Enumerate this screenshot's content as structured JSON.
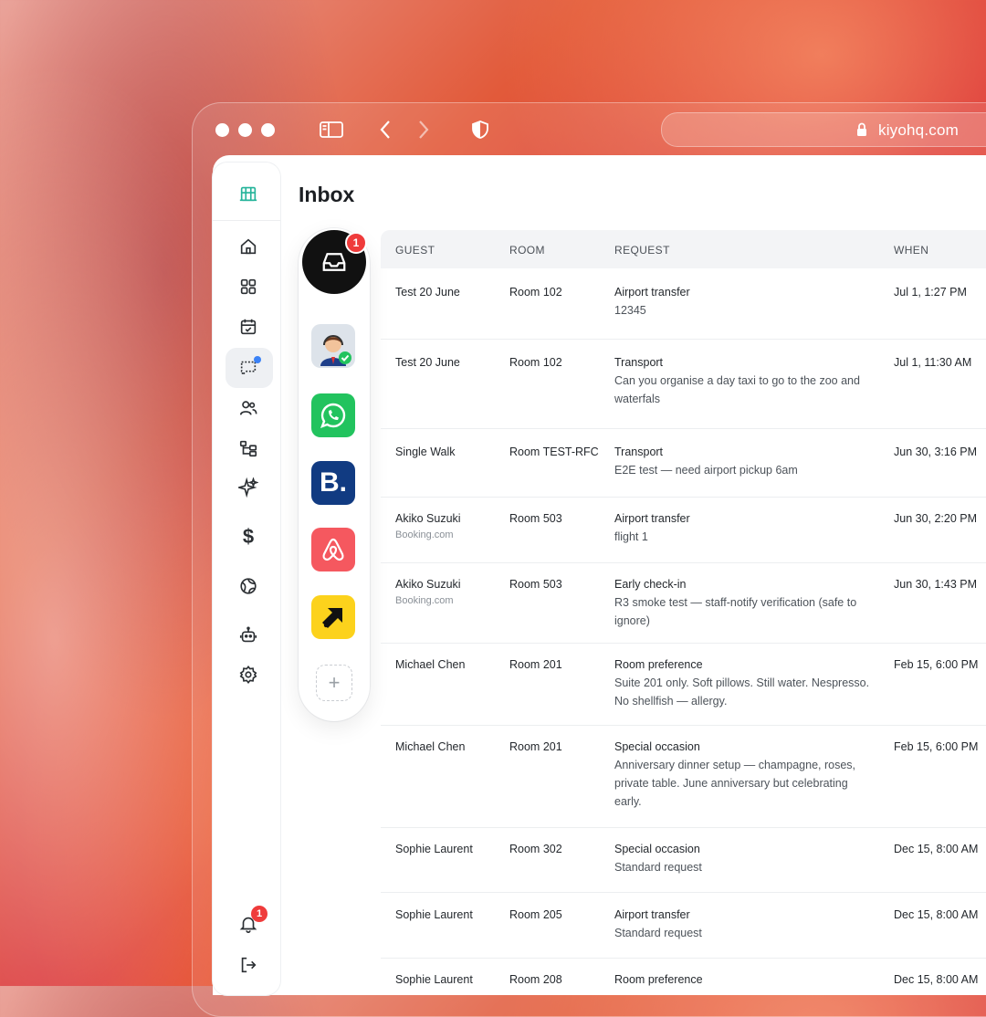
{
  "browser": {
    "url": "kiyohq.com"
  },
  "page": {
    "title": "Inbox"
  },
  "sidebar": {
    "items": [
      {
        "icon": "hotel-logo-icon"
      },
      {
        "icon": "home-icon"
      },
      {
        "icon": "grid-icon"
      },
      {
        "icon": "calendar-icon"
      },
      {
        "icon": "messages-icon",
        "active": true
      },
      {
        "icon": "users-icon"
      },
      {
        "icon": "hierarchy-icon"
      },
      {
        "icon": "sparkle-icon"
      },
      {
        "icon": "dollar-icon"
      },
      {
        "icon": "globe-icon"
      },
      {
        "icon": "bot-icon"
      },
      {
        "icon": "settings-icon"
      }
    ],
    "bottom": {
      "notifications_badge": "1",
      "logout_icon": "logout-icon"
    }
  },
  "channels": {
    "inbox_badge": "1",
    "items": [
      {
        "name": "inbox",
        "icon": "inbox-tray-icon"
      },
      {
        "name": "agent",
        "icon": "support-agent-icon"
      },
      {
        "name": "whatsapp",
        "icon": "whatsapp-icon"
      },
      {
        "name": "booking",
        "icon": "booking-icon",
        "glyph": "B."
      },
      {
        "name": "airbnb",
        "icon": "airbnb-icon"
      },
      {
        "name": "expedia",
        "icon": "expedia-icon"
      }
    ],
    "add_label": "+"
  },
  "table": {
    "headers": {
      "guest": "GUEST",
      "room": "ROOM",
      "request": "REQUEST",
      "when": "WHEN"
    },
    "rows": [
      {
        "guest": "Test 20 June",
        "source": "",
        "room": "Room 102",
        "request": "Airport transfer",
        "detail": "12345",
        "when": "Jul 1, 1:27 PM"
      },
      {
        "guest": "Test 20 June",
        "source": "",
        "room": "Room 102",
        "request": "Transport",
        "detail": "Can you organise a day taxi to go to the zoo and waterfals",
        "when": "Jul 1, 11:30 AM"
      },
      {
        "guest": "Single Walk",
        "source": "",
        "room": "Room TEST-RFC",
        "request": "Transport",
        "detail": "E2E test — need airport pickup 6am",
        "when": "Jun 30, 3:16 PM"
      },
      {
        "guest": "Akiko Suzuki",
        "source": "Booking.com",
        "room": "Room 503",
        "request": "Airport transfer",
        "detail": "flight 1",
        "when": "Jun 30, 2:20 PM"
      },
      {
        "guest": "Akiko Suzuki",
        "source": "Booking.com",
        "room": "Room 503",
        "request": "Early check-in",
        "detail": "R3 smoke test — staff-notify verification (safe to ignore)",
        "when": "Jun 30, 1:43 PM"
      },
      {
        "guest": "Michael Chen",
        "source": "",
        "room": "Room 201",
        "request": "Room preference",
        "detail": "Suite 201 only. Soft pillows. Still water. Nespresso. No shellfish — allergy.",
        "when": "Feb 15, 6:00 PM"
      },
      {
        "guest": "Michael Chen",
        "source": "",
        "room": "Room 201",
        "request": "Special occasion",
        "detail": "Anniversary dinner setup — champagne, roses, private table. June anniversary but celebrating early.",
        "when": "Feb 15, 6:00 PM"
      },
      {
        "guest": "Sophie Laurent",
        "source": "",
        "room": "Room 302",
        "request": "Special occasion",
        "detail": "Standard request",
        "when": "Dec 15, 8:00 AM"
      },
      {
        "guest": "Sophie Laurent",
        "source": "",
        "room": "Room 205",
        "request": "Airport transfer",
        "detail": "Standard request",
        "when": "Dec 15, 8:00 AM"
      },
      {
        "guest": "Sophie Laurent",
        "source": "",
        "room": "Room 208",
        "request": "Room preference",
        "detail": "",
        "when": "Dec 15, 8:00 AM"
      }
    ]
  }
}
